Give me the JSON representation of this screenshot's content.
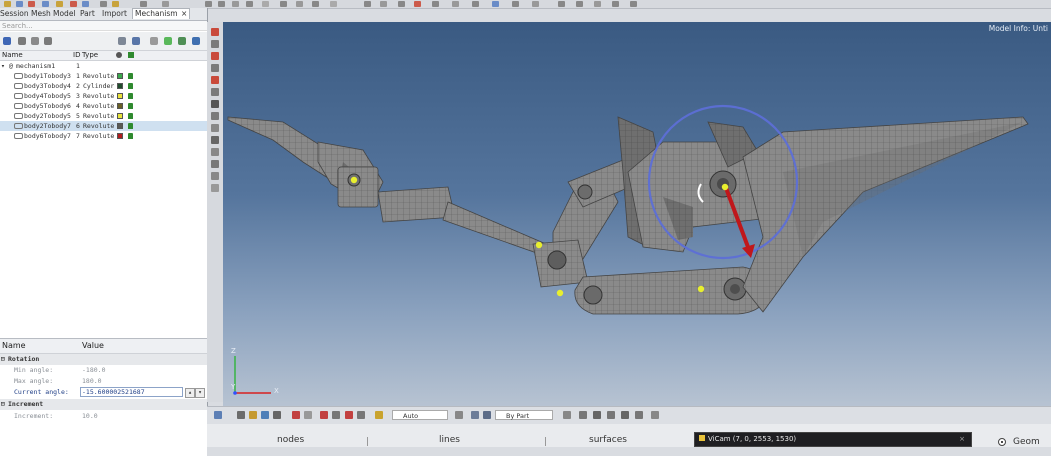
{
  "top_tabs": [
    "Session",
    "Mesh",
    "Model",
    "Part",
    "Import",
    "Mechanism"
  ],
  "top_tab_close": "×",
  "search_placeholder": "Search...",
  "tree": {
    "columns": {
      "name": "Name",
      "id": "ID",
      "type": "Type"
    },
    "root": {
      "label": "mechanism1",
      "id": "1"
    },
    "rows": [
      {
        "name": "body1Tobody3",
        "id": "1",
        "type": "Revolute",
        "color": "#3aa84c"
      },
      {
        "name": "body3Tobody4",
        "id": "2",
        "type": "Cylinder",
        "color": "#1f4d2c"
      },
      {
        "name": "body4Tobody5",
        "id": "3",
        "type": "Revolute",
        "color": "#e8e03a"
      },
      {
        "name": "body5Tobody6",
        "id": "4",
        "type": "Revolute",
        "color": "#6b6126"
      },
      {
        "name": "body2Tobody5",
        "id": "5",
        "type": "Revolute",
        "color": "#e6e23a"
      },
      {
        "name": "body2Tobody7",
        "id": "6",
        "type": "Revolute",
        "color": "#5a5a55"
      },
      {
        "name": "body6Tobody7",
        "id": "7",
        "type": "Revolute",
        "color": "#b11d1d"
      }
    ],
    "selected_index": 5
  },
  "properties": {
    "header_name": "Name",
    "header_value": "Value",
    "groups": [
      {
        "label": "Rotation",
        "rows": [
          {
            "name": "Min angle:",
            "value": "-180.0"
          },
          {
            "name": "Max angle:",
            "value": "180.0"
          },
          {
            "name": "Current angle:",
            "value": "-15.600002521687",
            "active": true
          }
        ]
      },
      {
        "label": "Increment",
        "rows": [
          {
            "name": "Increment:",
            "value": "10.0"
          }
        ]
      }
    ]
  },
  "viewport": {
    "model_info": "Model Info: Unti",
    "axis_z": "Z",
    "axis_y": "Y",
    "axis_x": "X"
  },
  "vp_toolbar": {
    "auto_label": "Auto",
    "bypart_label": "By Part"
  },
  "entity_tabs": [
    "nodes",
    "lines",
    "surfaces"
  ],
  "cam_dialog": "ViCam (7, 0, 2553, 1530)",
  "cam_close": "×",
  "geom_label": "Geom",
  "colors": {
    "accent_blue": "#5d6fd6",
    "arrow_red": "#c0171b",
    "joint_yellow": "#e8ef2e",
    "mesh_gray": "#8d8d8d"
  }
}
